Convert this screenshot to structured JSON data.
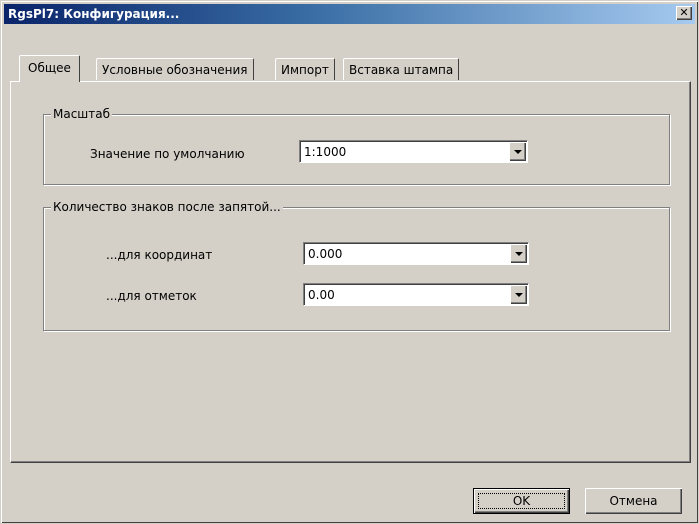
{
  "window": {
    "title": "RgsPl7: Конфигурация...",
    "close_glyph": "✕"
  },
  "tabs": [
    {
      "label": "Общее",
      "active": true
    },
    {
      "label": "Условные обозначения",
      "active": false
    },
    {
      "label": "Импорт",
      "active": false
    },
    {
      "label": "Вставка штампа",
      "active": false
    }
  ],
  "scale_group": {
    "legend": "Масштаб",
    "default_label": "Значение по умолчанию",
    "default_value": "1:1000"
  },
  "decimals_group": {
    "legend": "Количество знаков после запятой...",
    "coords_label": "...для координат",
    "coords_value": "0.000",
    "marks_label": "...для отметок",
    "marks_value": "0.00"
  },
  "buttons": {
    "ok": "OK",
    "cancel": "Отмена"
  },
  "icons": {
    "close": "close-icon",
    "dropdown": "chevron-down-icon"
  }
}
